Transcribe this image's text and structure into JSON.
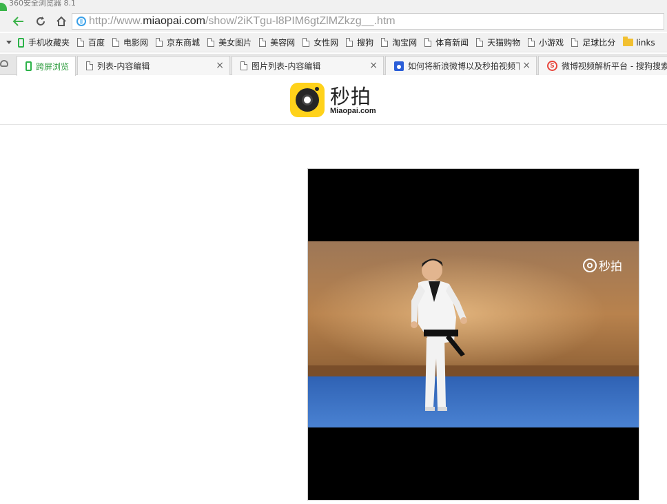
{
  "window": {
    "title": "360安全浏览器 8.1"
  },
  "address_bar": {
    "url_prefix": "http://www.",
    "url_domain": "miaopai.com",
    "url_path": "/show/2iKTgu-l8PIM6gtZlMZkzg__.htm"
  },
  "bookmarks": {
    "items": [
      {
        "label": "手机收藏夹",
        "icon": "phone-icon"
      },
      {
        "label": "百度",
        "icon": "page-icon"
      },
      {
        "label": "电影网",
        "icon": "page-icon"
      },
      {
        "label": "京东商城",
        "icon": "page-icon"
      },
      {
        "label": "美女图片",
        "icon": "page-icon"
      },
      {
        "label": "美容网",
        "icon": "page-icon"
      },
      {
        "label": "女性网",
        "icon": "page-icon"
      },
      {
        "label": "搜狗",
        "icon": "page-icon"
      },
      {
        "label": "淘宝网",
        "icon": "page-icon"
      },
      {
        "label": "体育新闻",
        "icon": "page-icon"
      },
      {
        "label": "天猫购物",
        "icon": "page-icon"
      },
      {
        "label": "小游戏",
        "icon": "page-icon"
      },
      {
        "label": "足球比分",
        "icon": "page-icon"
      },
      {
        "label": "links",
        "icon": "folder-icon"
      }
    ]
  },
  "tabs": [
    {
      "label": "跨屏浏览",
      "icon": "phone-icon",
      "active": true
    },
    {
      "label": "列表-内容编辑",
      "icon": "page-icon",
      "active": false
    },
    {
      "label": "图片列表-内容编辑",
      "icon": "page-icon",
      "active": false
    },
    {
      "label": "如何将新浪微博以及秒拍视频下",
      "icon": "paw-icon",
      "active": false
    },
    {
      "label": "微博视频解析平台 - 搜狗搜索",
      "icon": "sogou-icon",
      "active": false
    }
  ],
  "site": {
    "logo_cn": "秒拍",
    "logo_en": "Miaopai.com"
  },
  "video": {
    "watermark": "秒拍",
    "colors": {
      "wall": "#b37a45",
      "floor": "#3d74c6",
      "uniform": "#f2f2f2",
      "belt": "#111111"
    }
  }
}
